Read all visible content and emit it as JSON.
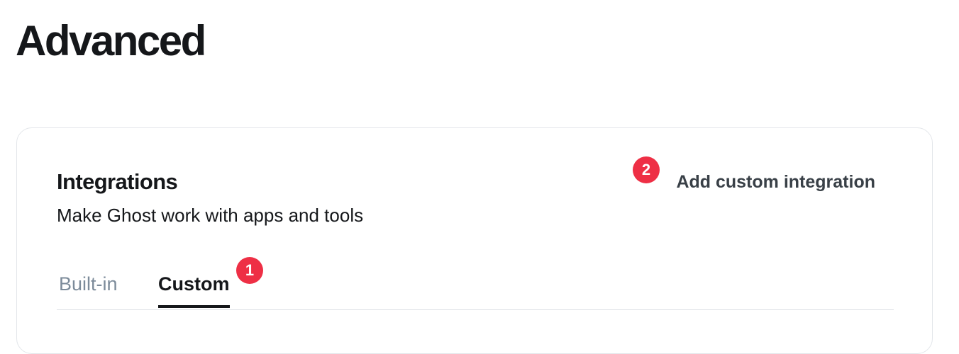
{
  "page": {
    "title": "Advanced"
  },
  "integrations": {
    "title": "Integrations",
    "description": "Make Ghost work with apps and tools",
    "add_label": "Add custom integration",
    "tabs": [
      {
        "label": "Built-in",
        "active": false
      },
      {
        "label": "Custom",
        "active": true
      }
    ]
  },
  "markers": [
    "1",
    "2"
  ],
  "colors": {
    "text": "#15171a",
    "muted_tab": "#7c8b9a",
    "link": "#394047",
    "marker": "#ee2f45",
    "border": "#e3e6ea"
  }
}
